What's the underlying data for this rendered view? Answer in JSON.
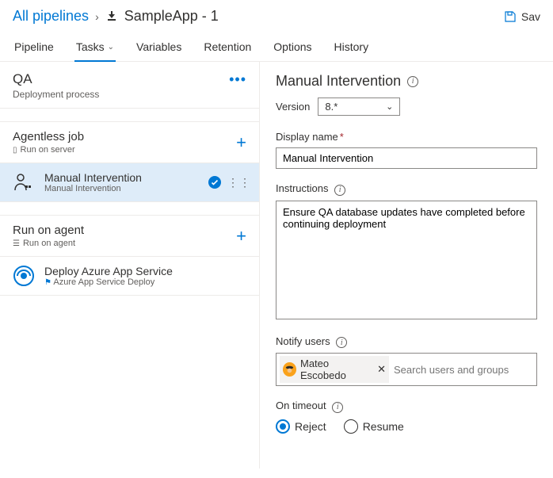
{
  "header": {
    "breadcrumb_root": "All pipelines",
    "title": "SampleApp - 1",
    "save_label": "Sav"
  },
  "tabs": {
    "pipeline": "Pipeline",
    "tasks": "Tasks",
    "variables": "Variables",
    "retention": "Retention",
    "options": "Options",
    "history": "History"
  },
  "left": {
    "stage_title": "QA",
    "stage_sub": "Deployment process",
    "job1_title": "Agentless job",
    "job1_sub": "Run on server",
    "task1_title": "Manual Intervention",
    "task1_sub": "Manual Intervention",
    "job2_title": "Run on agent",
    "job2_sub": "Run on agent",
    "task2_title": "Deploy Azure App Service",
    "task2_sub": "Azure App Service Deploy"
  },
  "panel": {
    "title": "Manual Intervention",
    "version_label": "Version",
    "version_value": "8.*",
    "display_name_label": "Display name",
    "display_name_value": "Manual Intervention",
    "instructions_label": "Instructions",
    "instructions_value": "Ensure QA database updates have completed before continuing deployment",
    "notify_label": "Notify users",
    "notify_person": "Mateo Escobedo",
    "notify_placeholder": "Search users and groups",
    "timeout_label": "On timeout",
    "reject": "Reject",
    "resume": "Resume"
  }
}
